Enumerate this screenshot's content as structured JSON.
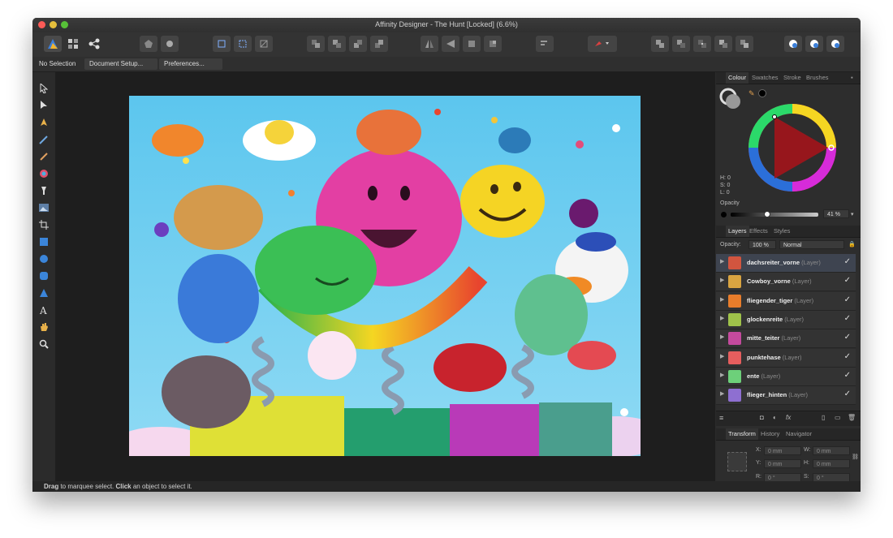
{
  "window": {
    "title": "Affinity Designer - The Hunt [Locked] (6.6%)"
  },
  "toolbar": {
    "personas": [
      "designer-persona-icon",
      "pixel-persona-icon",
      "export-persona-icon"
    ],
    "groups": [
      {
        "name": "sync-icons",
        "icons": [
          "sync-icon",
          "sync-settings-icon"
        ]
      },
      {
        "name": "snapping-icons",
        "icons": [
          "snap-bounding-icon",
          "snap-geometry-icon",
          "snap-options-icon"
        ]
      },
      {
        "name": "arrange-icons",
        "icons": [
          "move-back-icon",
          "move-back-one-icon",
          "move-forward-one-icon",
          "move-front-icon"
        ]
      },
      {
        "name": "flip-rotate-icons",
        "icons": [
          "flip-horizontal-icon",
          "flip-vertical-icon",
          "rotate-left-icon",
          "rotate-right-icon"
        ]
      },
      {
        "name": "align-icons",
        "icons": [
          "align-icon"
        ]
      },
      {
        "name": "geometry-icons",
        "icons": [
          "geometry-icon"
        ]
      },
      {
        "name": "boolean-icons",
        "icons": [
          "add-icon",
          "subtract-icon",
          "intersect-icon",
          "divide-icon",
          "combine-icon"
        ]
      },
      {
        "name": "insert-icons",
        "icons": [
          "insert-behind-icon",
          "insert-top-icon",
          "insert-inside-icon"
        ]
      }
    ]
  },
  "contextbar": {
    "selection_label": "No Selection",
    "document_setup": "Document Setup...",
    "preferences": "Preferences..."
  },
  "tools": [
    "move-tool-icon",
    "node-tool-icon",
    "pen-tool-icon",
    "pencil-tool-icon",
    "brush-tool-icon",
    "fill-tool-icon",
    "transparency-tool-icon",
    "place-image-icon",
    "crop-tool-icon",
    "rectangle-tool-icon",
    "ellipse-tool-icon",
    "rounded-rect-tool-icon",
    "triangle-tool-icon",
    "text-tool-icon",
    "hand-tool-icon",
    "zoom-tool-icon"
  ],
  "colour_panel": {
    "tabs": [
      "Colour",
      "Swatches",
      "Stroke",
      "Brushes"
    ],
    "hsl": {
      "h": "H: 0",
      "s": "S: 0",
      "l": "L: 0"
    },
    "opacity_label": "Opacity",
    "opacity_value": "41 %",
    "opacity_level": 0.41,
    "hue_color": "#e8232b"
  },
  "layers_panel": {
    "tabs": [
      "Layers",
      "Effects",
      "Styles"
    ],
    "opacity_label": "Opacity:",
    "opacity_value": "100 %",
    "blend_mode": "Normal",
    "layers": [
      {
        "name": "dachsreiter_vorne",
        "type": "(Layer)",
        "color": "#d2553f"
      },
      {
        "name": "Cowboy_vorne",
        "type": "(Layer)",
        "color": "#d9a441"
      },
      {
        "name": "fliegender_tiger",
        "type": "(Layer)",
        "color": "#e87d2b"
      },
      {
        "name": "glockenreite",
        "type": "(Layer)",
        "color": "#9fc24a"
      },
      {
        "name": "mitte_teiter",
        "type": "(Layer)",
        "color": "#c44a9d"
      },
      {
        "name": "punktehase",
        "type": "(Layer)",
        "color": "#e65e5e"
      },
      {
        "name": "ente",
        "type": "(Layer)",
        "color": "#6dd07a"
      },
      {
        "name": "flieger_hinten",
        "type": "(Layer)",
        "color": "#8e6fd1"
      }
    ]
  },
  "transform_panel": {
    "tabs": [
      "Transform",
      "History",
      "Navigator"
    ],
    "x_label": "X:",
    "x_value": "0 mm",
    "y_label": "Y:",
    "y_value": "0 mm",
    "w_label": "W:",
    "w_value": "0 mm",
    "h_label": "H:",
    "h_value": "0 mm",
    "r_label": "R:",
    "r_value": "0 °",
    "s_label": "S:",
    "s_value": "0 °"
  },
  "status": {
    "bold1": "Drag",
    "text1": " to marquee select. ",
    "bold2": "Click",
    "text2": " an object to select it."
  }
}
